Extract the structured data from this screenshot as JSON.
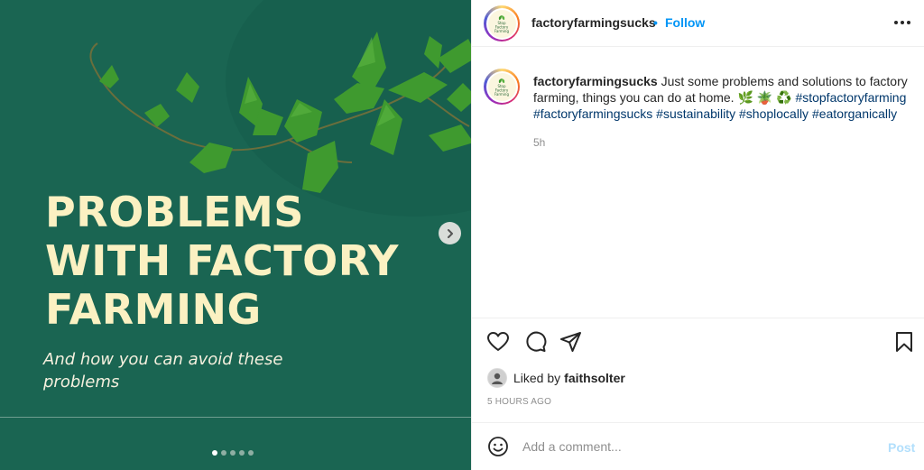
{
  "image": {
    "headline_lines": [
      "PROBLEMS",
      "WITH FACTORY",
      "FARMING"
    ],
    "subline_lines": [
      "And how you can avoid these",
      "problems"
    ],
    "carousel": {
      "total": 5,
      "active": 1
    },
    "colors": {
      "background": "#1a6552",
      "headline": "#fbf1c2"
    }
  },
  "header": {
    "username": "factoryfarmingsucks",
    "separator": "•",
    "follow_label": "Follow",
    "avatar_logo_lines": [
      "Stop",
      "Factory",
      "Farming"
    ]
  },
  "caption": {
    "username": "factoryfarmingsucks",
    "text": "Just some problems and solutions to factory farming, things you can do at home. 🌿 🪴 ♻️",
    "hashtags": [
      "#stopfactoryfarming",
      "#factoryfarmingsucks",
      "#sustainability",
      "#shoplocally",
      "#eatorganically"
    ],
    "time": "5h"
  },
  "likes": {
    "prefix": "Liked by",
    "user": "faithsolter"
  },
  "timestamp": "5 HOURS AGO",
  "comment": {
    "placeholder": "Add a comment...",
    "post_label": "Post"
  },
  "colors": {
    "follow": "#0095f6",
    "hashtag": "#00376b",
    "post_disabled": "#b2dffc"
  }
}
